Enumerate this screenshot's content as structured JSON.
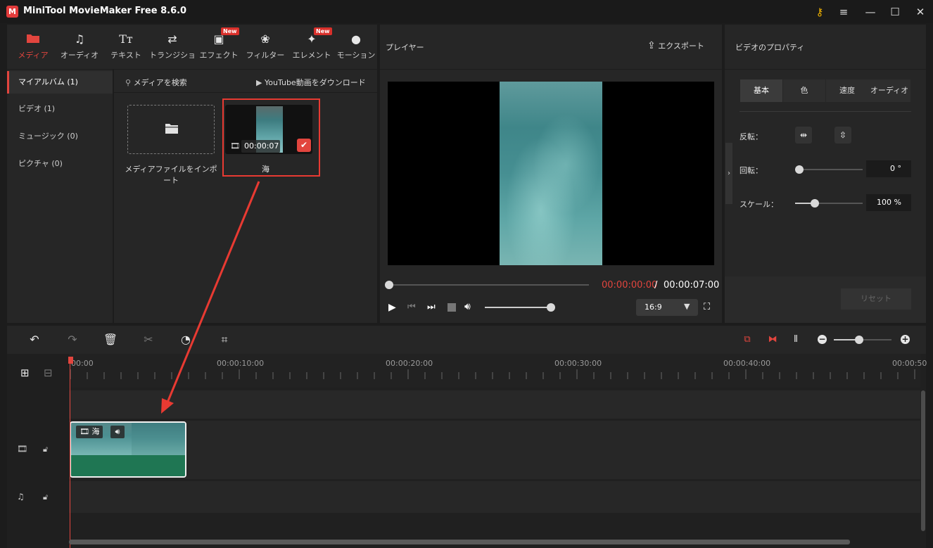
{
  "app": {
    "logo_text": "M",
    "title": "MiniTool MovieMaker Free 8.6.0"
  },
  "window": {
    "key_icon": "key-icon",
    "menu": "≡",
    "minimize": "—",
    "maximize": "☐",
    "close": "✕"
  },
  "toolbar": {
    "items": [
      {
        "label": "メディア",
        "icon": "folder-icon"
      },
      {
        "label": "オーディオ",
        "icon": "music-note-icon"
      },
      {
        "label": "テキスト",
        "icon": "text-icon"
      },
      {
        "label": "トランジショ",
        "icon": "transition-icon"
      },
      {
        "label": "エフェクト",
        "icon": "effect-icon"
      },
      {
        "label": "フィルター",
        "icon": "filter-icon"
      },
      {
        "label": "エレメント",
        "icon": "element-icon"
      },
      {
        "label": "モーション",
        "icon": "motion-icon"
      }
    ],
    "new_badge": "New"
  },
  "nav": {
    "items": [
      {
        "label": "マイアルバム (1)"
      },
      {
        "label": "ビデオ (1)"
      },
      {
        "label": "ミュージック (0)"
      },
      {
        "label": "ピクチャ (0)"
      }
    ]
  },
  "media": {
    "search_label": "メディアを検索",
    "youtube_label": "YouTube動画をダウンロード",
    "import_label": "メディアファイルをインポート",
    "clip_duration": "00:00:07",
    "clip_name": "海"
  },
  "player": {
    "title": "プレイヤー",
    "export_label": "エクスポート",
    "current_time": "00:00:00:00",
    "separator": " / ",
    "total_time": "00:00:07:00",
    "aspect": "16:9",
    "progress": 0,
    "volume": 1.0
  },
  "properties": {
    "title": "ビデオのプロパティ",
    "tabs": [
      "基本",
      "色",
      "速度",
      "オーディオ"
    ],
    "flip_label": "反転：",
    "rotate_label": "回転：",
    "rotate_value": "0 °",
    "scale_label": "スケール：",
    "scale_value": "100 %",
    "reset_label": "リセット"
  },
  "timeline": {
    "ticks": [
      "00:00",
      "00:00:10:00",
      "00:00:20:00",
      "00:00:30:00",
      "00:00:40:00",
      "00:00:50"
    ],
    "clip_name": "海",
    "zoom": 0.6
  },
  "colors": {
    "accent": "#e2453e",
    "audio_track": "#1f7653",
    "highlight": "#e83a32"
  }
}
